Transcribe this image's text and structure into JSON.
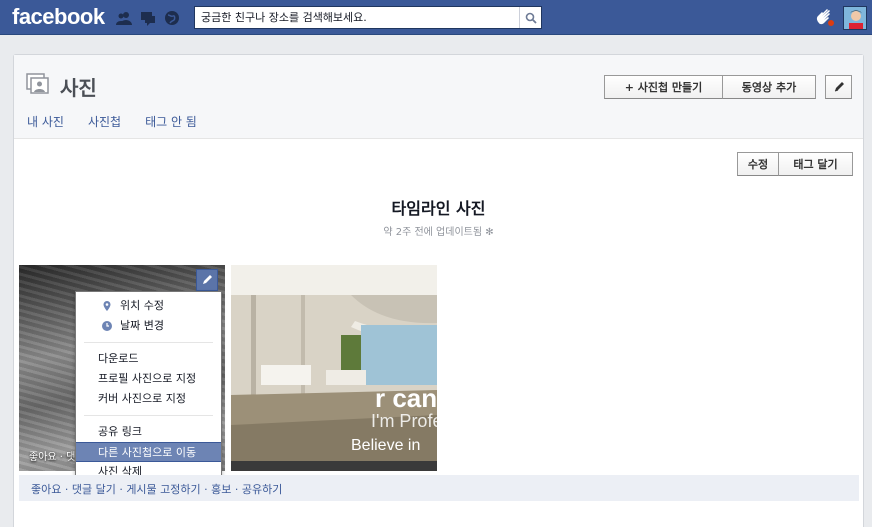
{
  "topbar": {
    "logo": "facebook",
    "search_placeholder": "궁금한 친구나 장소를 검색해보세요.",
    "icons": [
      "friends-icon",
      "messages-icon",
      "notifications-icon",
      "search-icon",
      "hand-icon"
    ]
  },
  "page": {
    "title": "사진",
    "tabs": [
      "내 사진",
      "사진첩",
      "태그 안 됨"
    ],
    "buttons": {
      "create_album": "+ 사진첩 만들기",
      "add_video": "동영상 추가",
      "edit": "수정",
      "tag": "태그 달기"
    }
  },
  "album": {
    "title": "타임라인 사진",
    "subtitle": "약 2주 전에 업데이트됨"
  },
  "photo1": {
    "meta": "좋아요 · 댓"
  },
  "photo2": {
    "overlay_big": "r can",
    "overlay_mid": "I'm Profe",
    "overlay_small": "Believe in"
  },
  "menu": {
    "items": [
      {
        "label": "위치 수정",
        "icon": "location-pin-icon"
      },
      {
        "label": "날짜 변경",
        "icon": "clock-icon"
      },
      {
        "label": "다운로드"
      },
      {
        "label": "프로필 사진으로 지정"
      },
      {
        "label": "커버 사진으로 지정"
      },
      {
        "label": "공유 링크"
      },
      {
        "label": "다른 사진첩으로 이동"
      },
      {
        "label": "사진 삭제"
      }
    ]
  },
  "actions": {
    "text": "좋아요 · 댓글 달기 · 게시물 고정하기 · 홍보 · 공유하기"
  },
  "colors": {
    "brand": "#3b5998",
    "menu_highlight": "#6d84b4"
  }
}
